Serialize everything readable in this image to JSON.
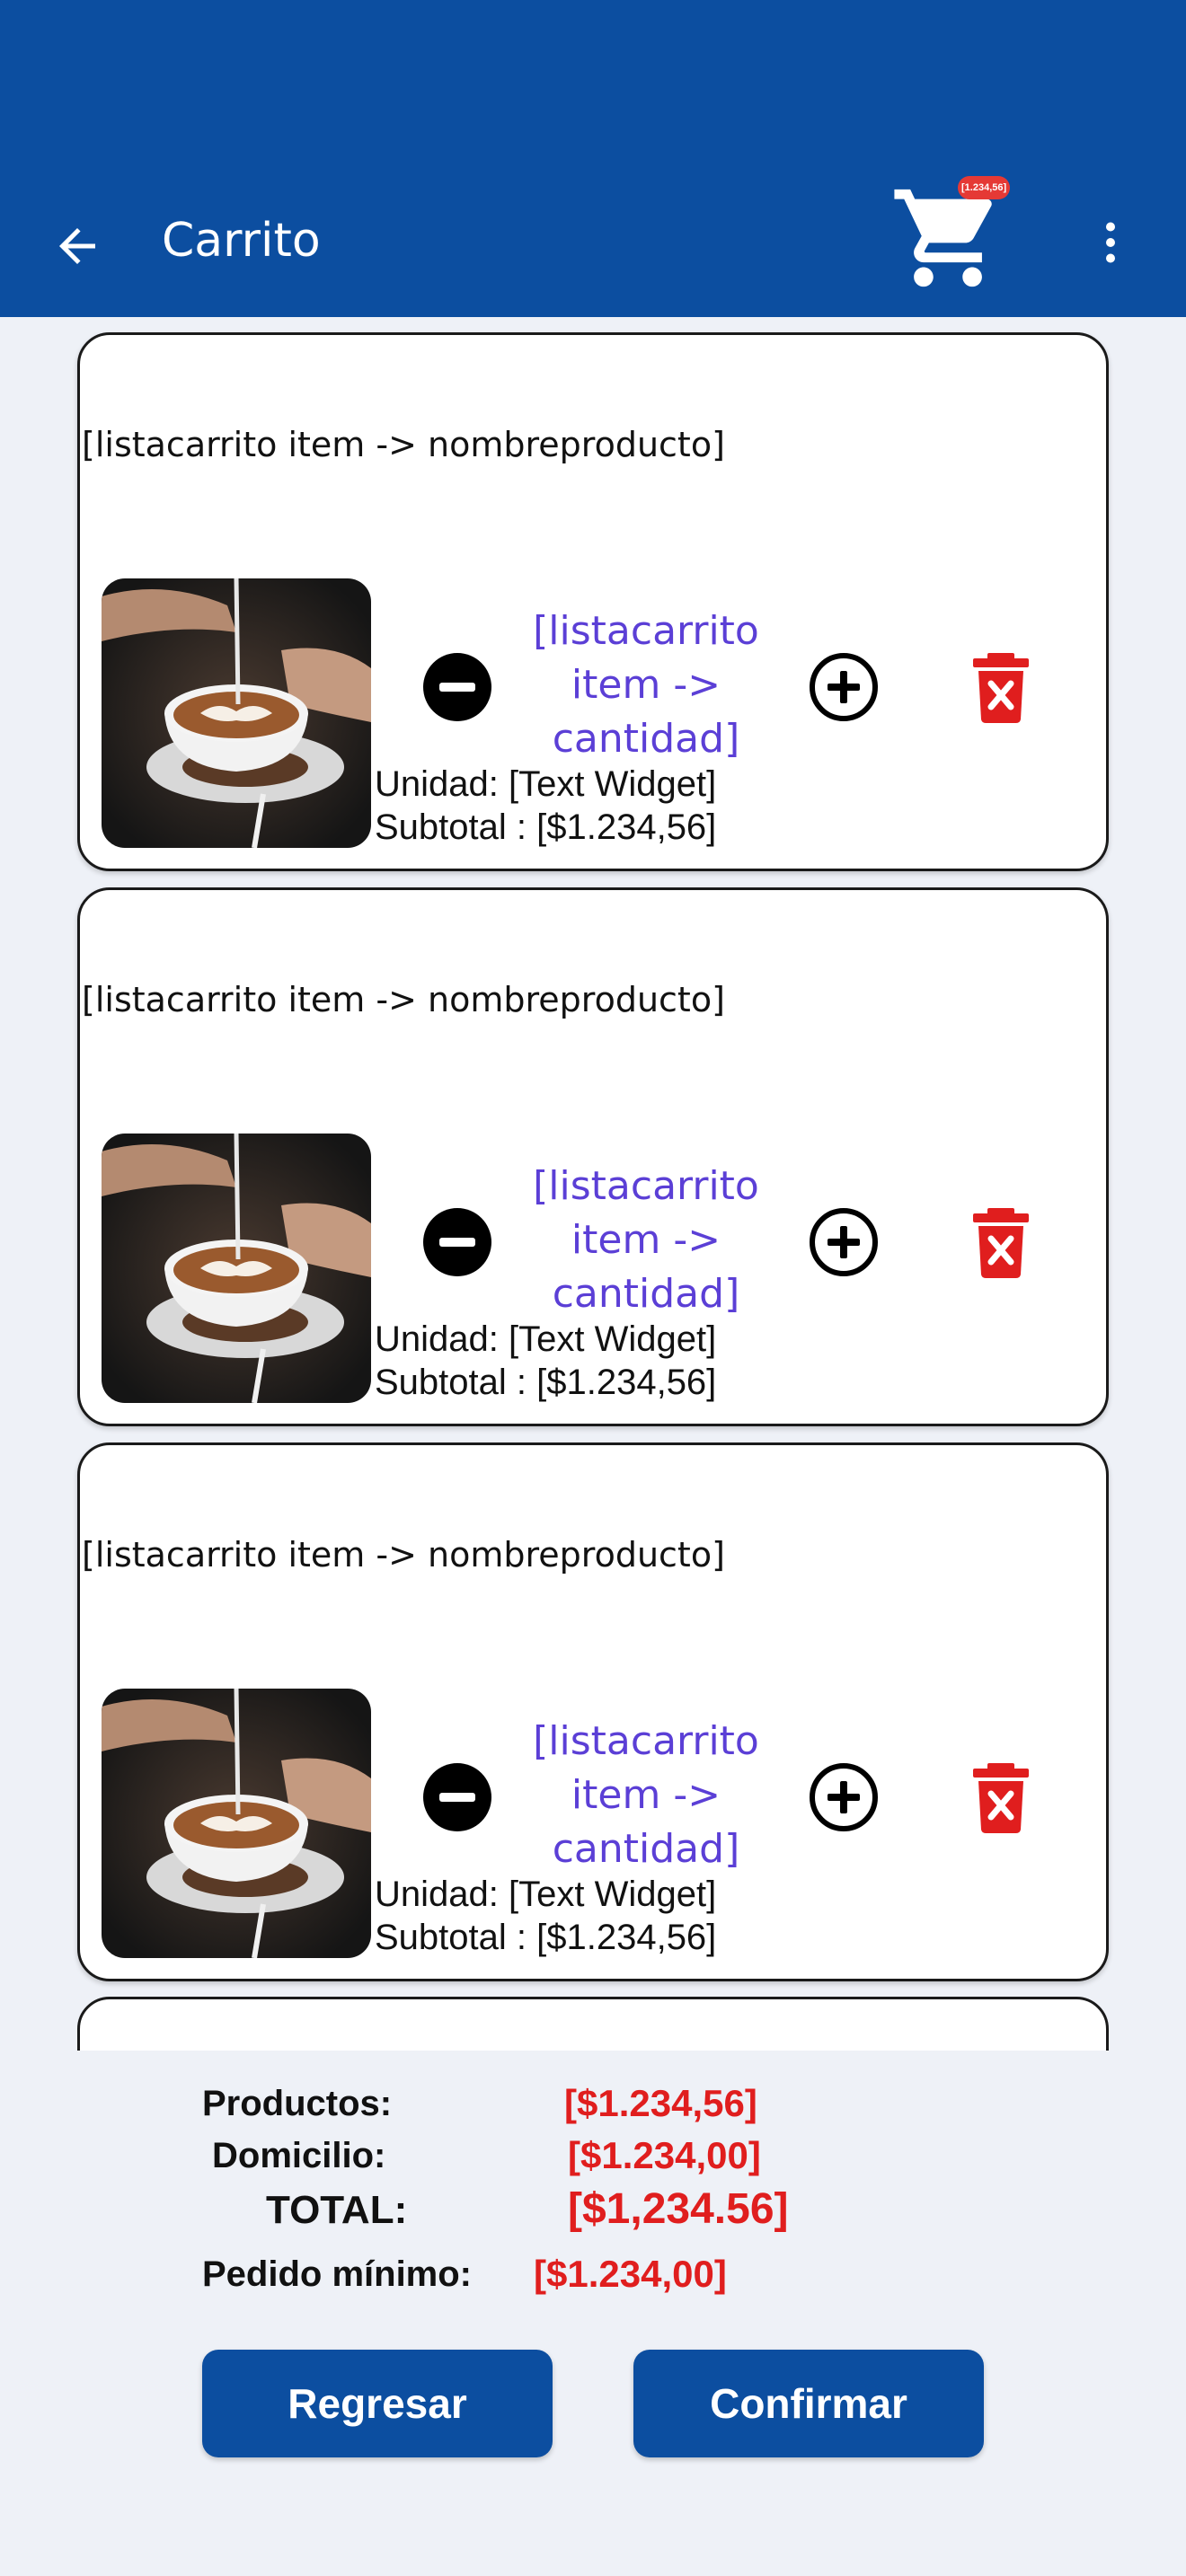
{
  "appbar": {
    "title": "Carrito",
    "cart_badge": "[1.234,56]",
    "back_icon": "arrow-left-icon",
    "cart_icon": "cart-icon",
    "more_icon": "more-vert-icon",
    "color": "#0c4ea0"
  },
  "cart_items": [
    {
      "name": "[listacarrito item -> nombreproducto]",
      "qty_line1": "[listacarrito",
      "qty_line2": "item ->",
      "qty_line3": "cantidad]",
      "unit": "Unidad: [Text Widget]",
      "subtotal": "Subtotal : [$1.234,56]",
      "image": "coffee-latte-art-photo"
    },
    {
      "name": "[listacarrito item -> nombreproducto]",
      "qty_line1": "[listacarrito",
      "qty_line2": "item ->",
      "qty_line3": "cantidad]",
      "unit": "Unidad: [Text Widget]",
      "subtotal": "Subtotal : [$1.234,56]",
      "image": "coffee-latte-art-photo"
    },
    {
      "name": "[listacarrito item -> nombreproducto]",
      "qty_line1": "[listacarrito",
      "qty_line2": "item ->",
      "qty_line3": "cantidad]",
      "unit": "Unidad: [Text Widget]",
      "subtotal": "Subtotal : [$1.234,56]",
      "image": "coffee-latte-art-photo"
    }
  ],
  "summary": {
    "productos_label": "Productos:",
    "productos_value": "[$1.234,56]",
    "domicilio_label": "Domicilio:",
    "domicilio_value": "[$1.234,00]",
    "total_label": "TOTAL:",
    "total_value": "[$1,234.56]",
    "minimo_label": "Pedido mínimo:",
    "minimo_value": "[$1.234,00]"
  },
  "buttons": {
    "back_label": "Regresar",
    "confirm_label": "Confirmar"
  }
}
